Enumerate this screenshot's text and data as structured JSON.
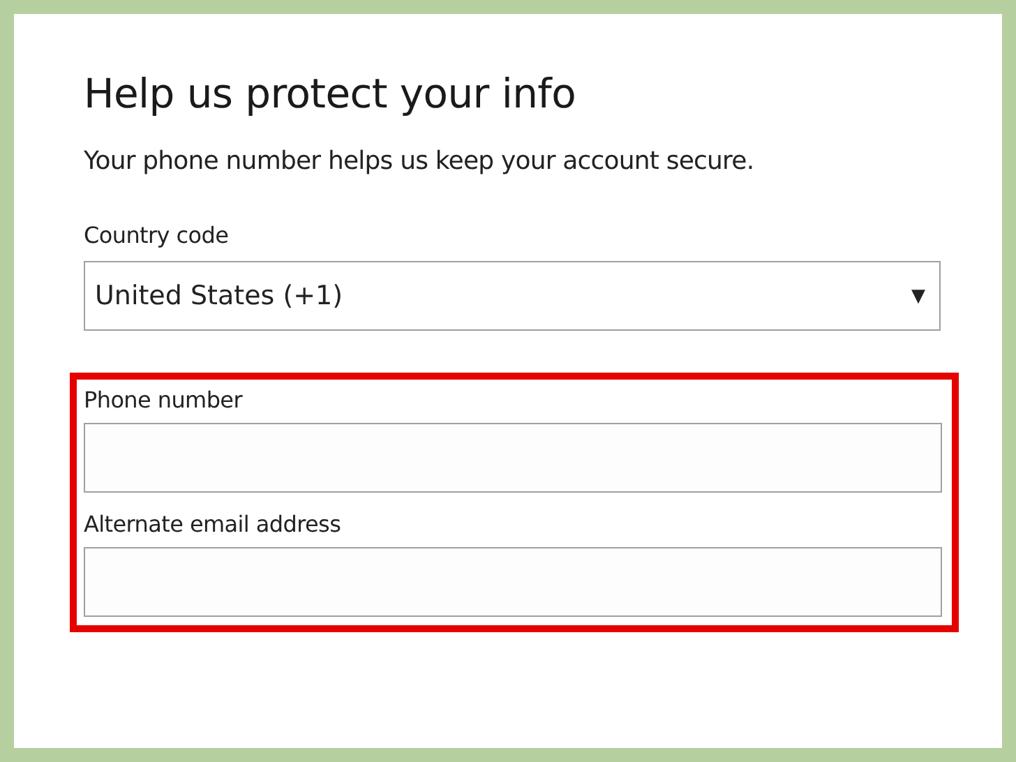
{
  "title": "Help us protect your info",
  "description": "Your phone number helps us keep your account secure.",
  "country": {
    "label": "Country code",
    "value": "United States (+1)",
    "caret": "▼"
  },
  "highlight_shown": true,
  "fields": [
    {
      "label": "Phone number"
    },
    {
      "label": "Alternate email address"
    }
  ]
}
